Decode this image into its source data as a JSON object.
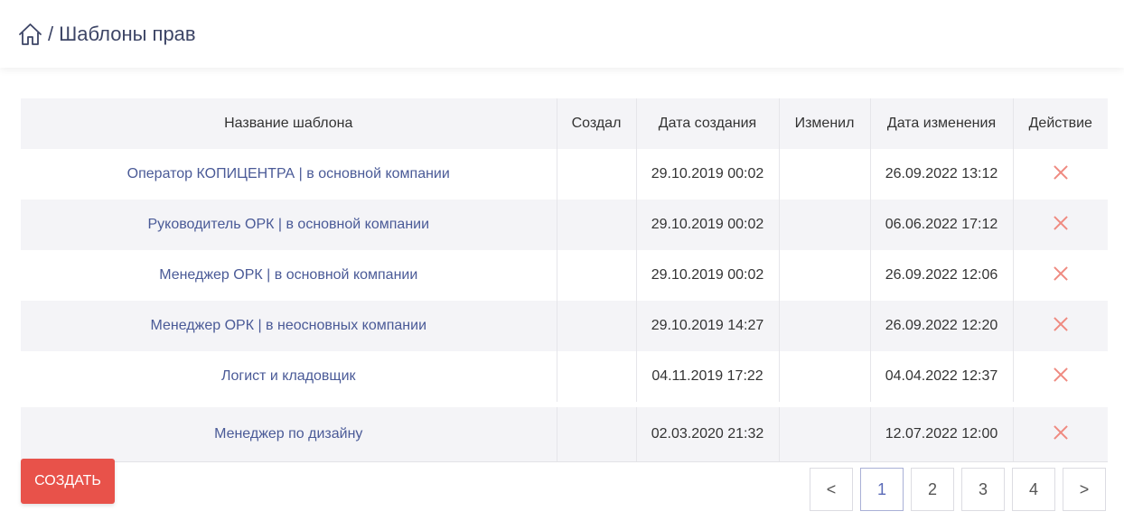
{
  "header": {
    "separator": "/",
    "title": "Шаблоны прав"
  },
  "table": {
    "columns": [
      "Название шаблона",
      "Создал",
      "Дата создания",
      "Изменил",
      "Дата изменения",
      "Действие"
    ],
    "rows": [
      {
        "name": "Оператор КОПИЦЕНТРА | в основной компании",
        "created_by": "",
        "created_at": "29.10.2019 00:02",
        "modified_by": "",
        "modified_at": "26.09.2022 13:12",
        "action": "delete-icon"
      },
      {
        "name": "Руководитель ОРК | в основной компании",
        "created_by": "",
        "created_at": "29.10.2019 00:02",
        "modified_by": "",
        "modified_at": "06.06.2022 17:12",
        "action": "delete-icon"
      },
      {
        "name": "Менеджер ОРК | в основной компании",
        "created_by": "",
        "created_at": "29.10.2019 00:02",
        "modified_by": "",
        "modified_at": "26.09.2022 12:06",
        "action": "delete-icon"
      },
      {
        "name": "Менеджер ОРК | в неосновных компании",
        "created_by": "",
        "created_at": "29.10.2019 14:27",
        "modified_by": "",
        "modified_at": "26.09.2022 12:20",
        "action": "delete-icon"
      },
      {
        "name": "Логист и кладовщик",
        "created_by": "",
        "created_at": "04.11.2019 17:22",
        "modified_by": "",
        "modified_at": "04.04.2022 12:37",
        "action": "delete-icon"
      },
      {
        "name": "Менеджер по дизайну",
        "created_by": "",
        "created_at": "02.03.2020 21:32",
        "modified_by": "",
        "modified_at": "12.07.2022 12:00",
        "action": "delete-icon"
      }
    ]
  },
  "create_button": {
    "label": "СОЗДАТЬ",
    "color": "#e8524a"
  },
  "pagination": {
    "prev": "<",
    "pages": [
      "1",
      "2",
      "3",
      "4"
    ],
    "current": "1",
    "next": ">"
  },
  "colors": {
    "accent": "#4a5a97",
    "danger": "#e8524a",
    "delete_icon": "#ef8a80",
    "header_bg": "#f4f4f7"
  }
}
